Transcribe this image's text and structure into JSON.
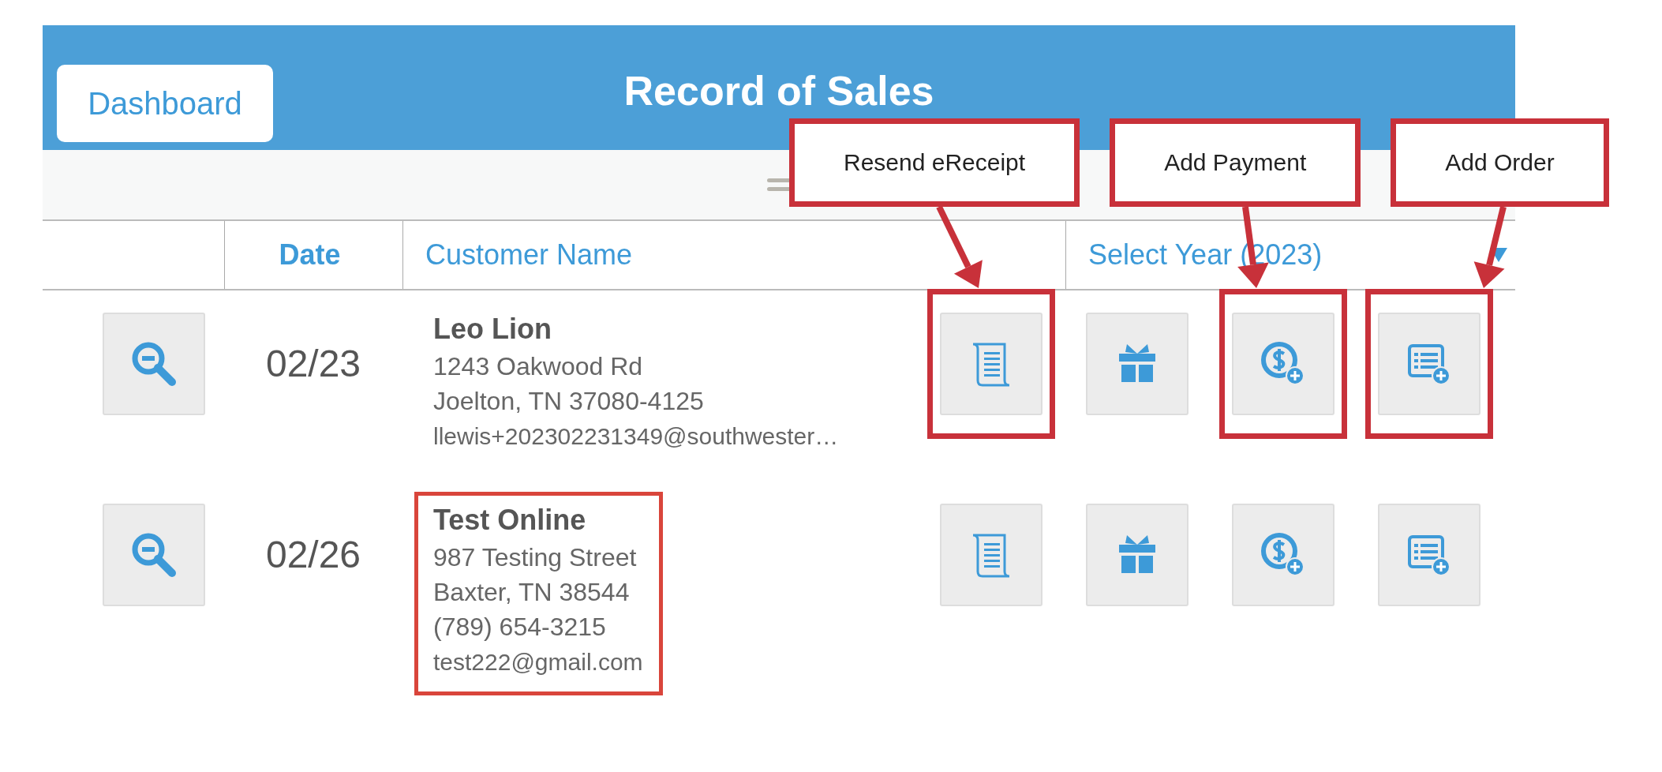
{
  "header": {
    "dashboard_button": "Dashboard",
    "title": "Record of Sales"
  },
  "table": {
    "columns": [
      {
        "label": "Date",
        "kind": "center"
      },
      {
        "label": "Customer Name",
        "kind": "left"
      },
      {
        "label": "Select Year (2023)",
        "kind": "dropdown"
      }
    ],
    "rows": [
      {
        "date": "02/23",
        "name": "Leo Lion",
        "lines": [
          "1243 Oakwood Rd",
          "Joelton, TN 37080-4125"
        ],
        "email": "llewis+202302231349@southwester…",
        "highlighted": false,
        "actions": [
          {
            "kind": "receipt",
            "highlighted": true
          },
          {
            "kind": "gift",
            "highlighted": false
          },
          {
            "kind": "payment",
            "highlighted": true
          },
          {
            "kind": "order",
            "highlighted": true
          }
        ]
      },
      {
        "date": "02/26",
        "name": "Test Online",
        "lines": [
          "987 Testing Street",
          "Baxter, TN 38544",
          "(789) 654-3215"
        ],
        "email": "test222@gmail.com",
        "highlighted": true,
        "actions": [
          {
            "kind": "receipt",
            "highlighted": false
          },
          {
            "kind": "gift",
            "highlighted": false
          },
          {
            "kind": "payment",
            "highlighted": false
          },
          {
            "kind": "order",
            "highlighted": false
          }
        ]
      }
    ]
  },
  "callouts": [
    {
      "label": "Resend eReceipt"
    },
    {
      "label": "Add Payment"
    },
    {
      "label": "Add Order"
    }
  ]
}
